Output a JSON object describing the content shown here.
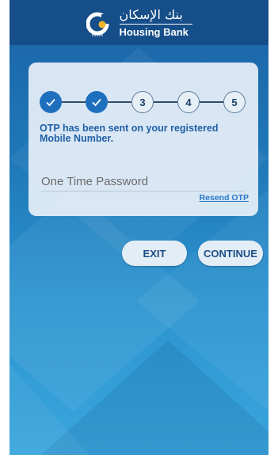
{
  "header": {
    "brand_arabic": "بنك الإسكان",
    "brand_english": "Housing Bank",
    "logo_icon": "housing-bank-logo"
  },
  "stepper": {
    "steps": [
      {
        "label": "",
        "state": "done"
      },
      {
        "label": "",
        "state": "done"
      },
      {
        "label": "3",
        "state": "pending"
      },
      {
        "label": "4",
        "state": "pending"
      },
      {
        "label": "5",
        "state": "pending"
      }
    ]
  },
  "otp": {
    "message": "OTP has been sent on your registered Mobile Number.",
    "placeholder": "One Time Password",
    "value": "",
    "resend_label": "Resend OTP"
  },
  "actions": {
    "exit_label": "EXIT",
    "continue_label": "CONTINUE"
  },
  "colors": {
    "header_bg": "#164e89",
    "accent": "#1f6fbf",
    "button_text": "#1d4f86"
  }
}
